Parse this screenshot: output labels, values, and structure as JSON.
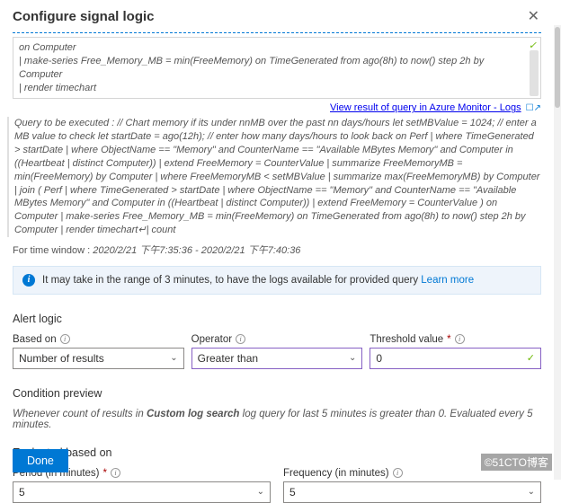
{
  "header": {
    "title": "Configure signal logic",
    "close_glyph": "✕"
  },
  "query_box": {
    "line1": "on Computer",
    "line2": "| make-series Free_Memory_MB = min(FreeMemory) on TimeGenerated from ago(8h) to now() step 2h by Computer",
    "line3": "| render timechart"
  },
  "view_result_link": "View result of query in Azure Monitor - Logs",
  "query_desc": "Query to be executed : // Chart memory if its under nnMB over the past nn days/hours let setMBValue = 1024; // enter a MB value to check let startDate = ago(12h); // enter how many days/hours to look back on Perf | where TimeGenerated > startDate | where ObjectName == \"Memory\" and CounterName == \"Available MBytes Memory\" and Computer in ((Heartbeat | distinct Computer)) | extend FreeMemory = CounterValue | summarize FreeMemoryMB = min(FreeMemory) by Computer | where FreeMemoryMB < setMBValue | summarize max(FreeMemoryMB) by Computer | join ( Perf | where TimeGenerated > startDate | where ObjectName == \"Memory\" and CounterName == \"Available MBytes Memory\" and Computer in ((Heartbeat | distinct Computer)) | extend FreeMemory = CounterValue ) on Computer | make-series Free_Memory_MB = min(FreeMemory) on TimeGenerated from ago(8h) to now() step 2h by Computer | render timechart↵| count",
  "time_window_label": "For time window :",
  "time_window_value": "2020/2/21 下午7:35:36 - 2020/2/21 下午7:40:36",
  "info_strip": {
    "text": "It may take in the range of 3 minutes, to have the logs available for provided query",
    "link": "Learn more"
  },
  "alert_logic_heading": "Alert logic",
  "based_on": {
    "label": "Based on",
    "value": "Number of results"
  },
  "operator": {
    "label": "Operator",
    "value": "Greater than"
  },
  "threshold": {
    "label": "Threshold value",
    "value": "0"
  },
  "condition_preview_heading": "Condition preview",
  "condition_text_pre": "Whenever count of results in ",
  "condition_text_bold": "Custom log search",
  "condition_text_post": " log query for last 5 minutes is greater than 0. Evaluated every 5 minutes.",
  "evaluated_heading": "Evaluated based on",
  "period": {
    "label": "Period (in minutes)",
    "value": "5"
  },
  "frequency": {
    "label": "Frequency (in minutes)",
    "value": "5"
  },
  "done_label": "Done",
  "watermark": "©51CTO博客"
}
